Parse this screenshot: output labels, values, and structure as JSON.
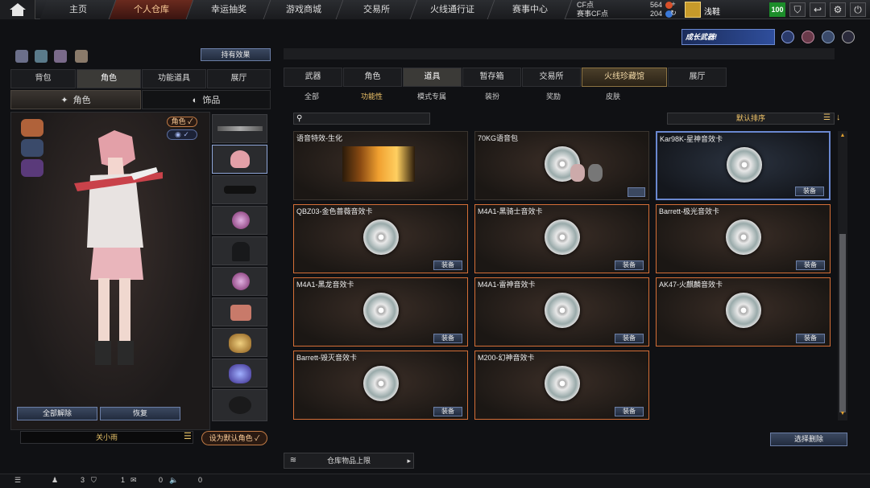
{
  "top_nav": {
    "tabs": [
      "主页",
      "个人仓库",
      "幸运抽奖",
      "游戏商城",
      "交易所",
      "火线通行证",
      "赛事中心"
    ],
    "active": "个人仓库",
    "cf_label": "CF点",
    "cf_value": "564",
    "match_cf_label": "赛事CF点",
    "match_cf_value": "204",
    "username": "浅鞋",
    "level": "100"
  },
  "left_panel": {
    "hold_effect": "持有效果",
    "tabs": [
      "背包",
      "角色",
      "功能道具",
      "展厅"
    ],
    "active_tab": "角色",
    "sub_tabs": [
      "角色",
      "饰品"
    ],
    "badge_role": "角色 ✓",
    "badge_eye": "◉ ✓",
    "unequip_all": "全部解除",
    "restore": "恢复",
    "char_name": "关小雨",
    "set_default": "设为默认角色 ✓"
  },
  "right_panel": {
    "banner": "成长武器!",
    "tabs": [
      "武器",
      "角色",
      "道具",
      "暂存箱",
      "交易所",
      "火线珍藏馆",
      "展厅"
    ],
    "active_tab": "道具",
    "sub_tabs": [
      "全部",
      "功能性",
      "模式专属",
      "装扮",
      "奖励",
      "皮肤"
    ],
    "active_sub": "功能性",
    "sort_label": "默认排序",
    "items": [
      {
        "title": "语音特效-生化",
        "equip": ""
      },
      {
        "title": "70KG语音包",
        "equip": ""
      },
      {
        "title": "Kar98K-星神音效卡",
        "equip": "装备"
      },
      {
        "title": "QBZ03-金色蔷薇音效卡",
        "equip": "装备"
      },
      {
        "title": "M4A1-黑骑士音效卡",
        "equip": "装备"
      },
      {
        "title": "Barrett-极光音效卡",
        "equip": "装备"
      },
      {
        "title": "M4A1-黑龙音效卡",
        "equip": "装备"
      },
      {
        "title": "M4A1-雷神音效卡",
        "equip": "装备"
      },
      {
        "title": "AK47-火麒麟音效卡",
        "equip": "装备"
      },
      {
        "title": "Barrett-毁灭音效卡",
        "equip": "装备"
      },
      {
        "title": "M200-幻神音效卡",
        "equip": "装备"
      }
    ],
    "batch_delete": "选择删除",
    "shelf": "仓库物品上限"
  },
  "status_bar": {
    "count_a": "3",
    "count_b": "1",
    "count_c": "0",
    "count_d": "0"
  }
}
